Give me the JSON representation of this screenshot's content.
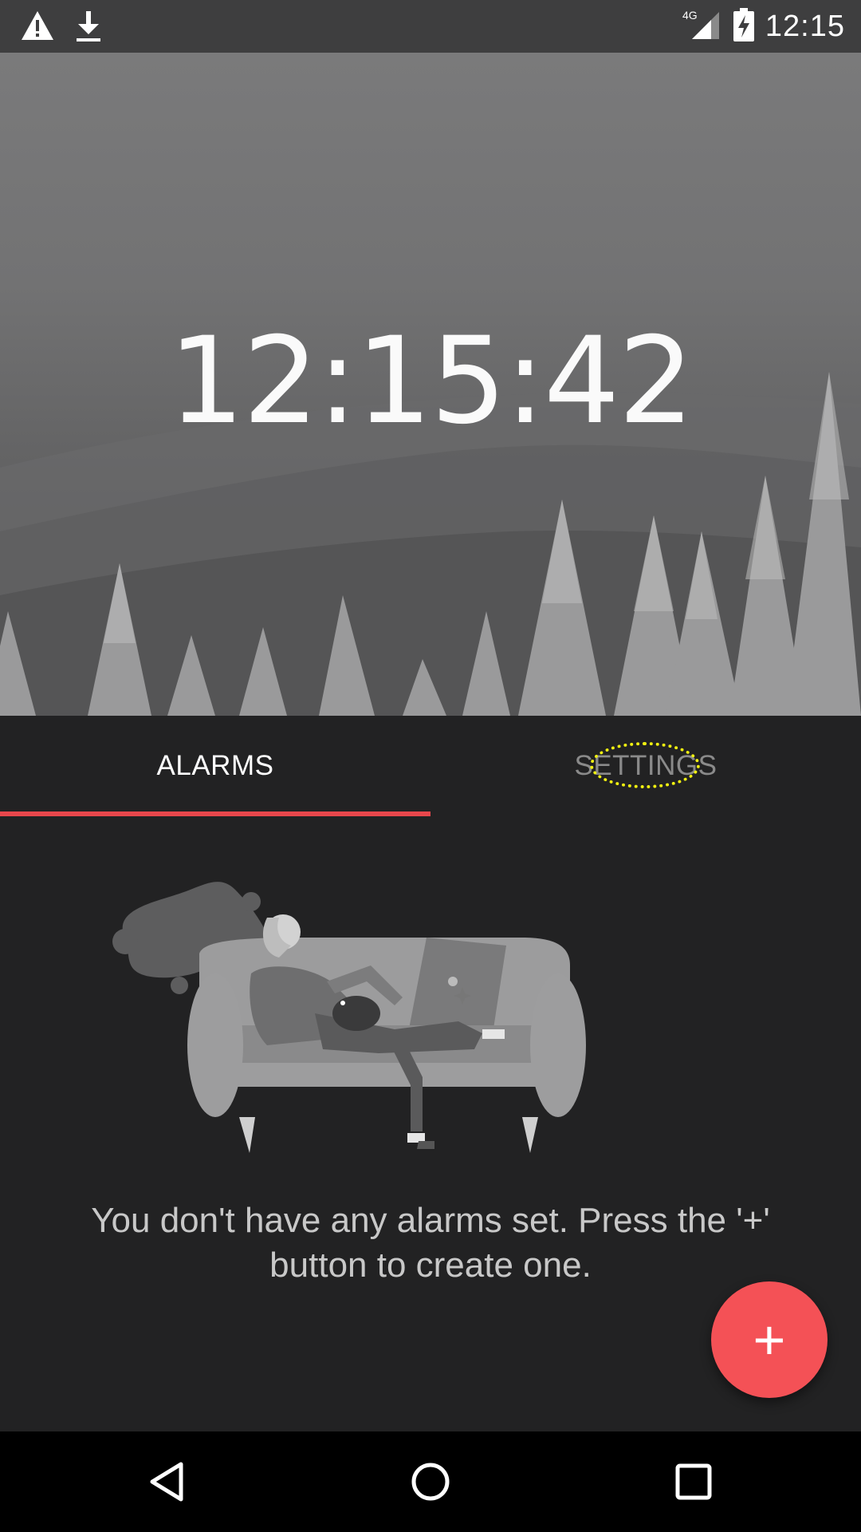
{
  "status_bar": {
    "time": "12:15",
    "network": "4G",
    "icons": [
      "warning-icon",
      "download-icon",
      "signal-icon",
      "battery-charging-icon"
    ]
  },
  "clock": {
    "time": "12:15:42"
  },
  "tabs": [
    {
      "label": "ALARMS",
      "selected": true
    },
    {
      "label": "SETTINGS",
      "selected": false
    }
  ],
  "empty_state": {
    "message": "You don't have any alarms set. Press the '+' button to create one."
  },
  "fab": {
    "icon": "plus-icon",
    "label": "+"
  },
  "nav": {
    "icons": [
      "back-icon",
      "home-icon",
      "recents-icon"
    ]
  },
  "colors": {
    "accent": "#f45156",
    "background": "#222223",
    "focus": "#f2f211"
  }
}
